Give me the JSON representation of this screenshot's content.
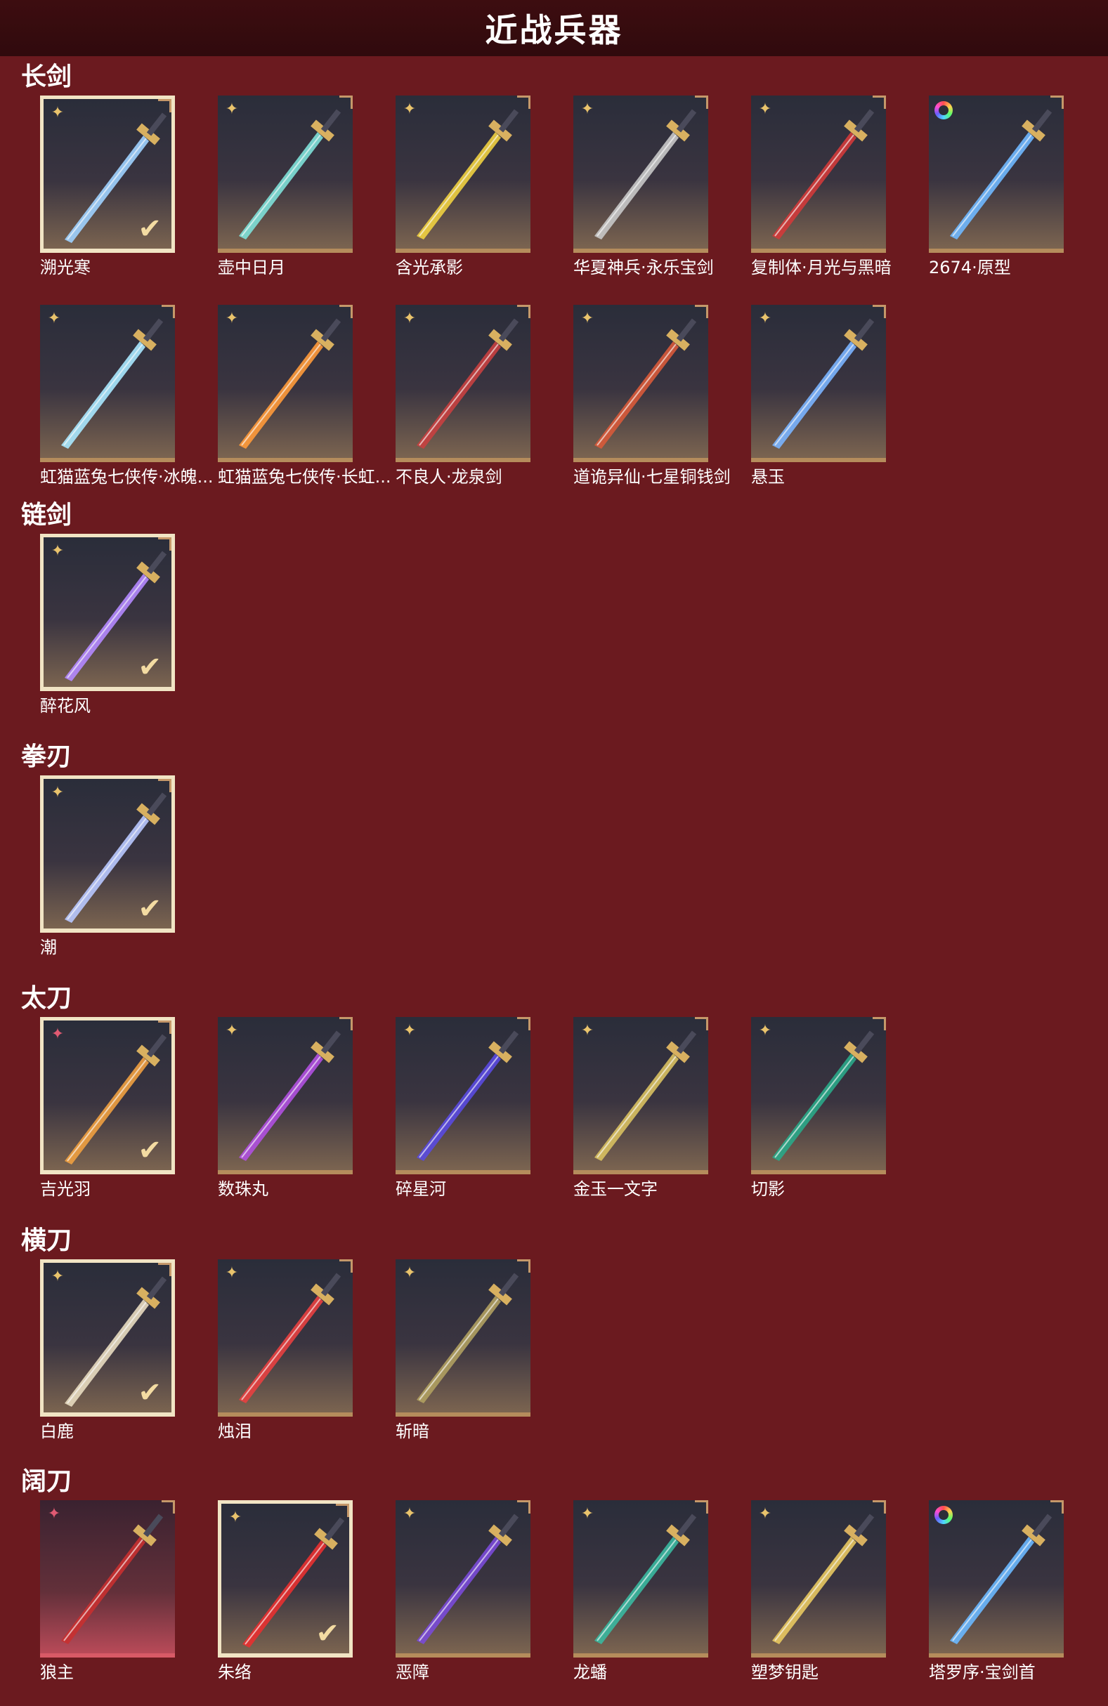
{
  "header": {
    "title": "近战兵器"
  },
  "categories": [
    {
      "label": "长剑",
      "items": [
        {
          "name": "溯光寒",
          "rarity": "gold",
          "owned": true,
          "color": "#9fd2ff"
        },
        {
          "name": "壶中日月",
          "rarity": "gold",
          "owned": false,
          "color": "#7ee0d8"
        },
        {
          "name": "含光承影",
          "rarity": "gold",
          "owned": false,
          "color": "#f0d040"
        },
        {
          "name": "华夏神兵·永乐宝剑",
          "rarity": "gold",
          "owned": false,
          "color": "#c8c8c8"
        },
        {
          "name": "复制体·月光与黑暗",
          "rarity": "gold",
          "owned": false,
          "color": "#d23a3a"
        },
        {
          "name": "2674·原型",
          "rarity": "rainbow",
          "owned": false,
          "color": "#6fb8ff"
        },
        {
          "name": "虹猫蓝兔七侠传·冰魄...",
          "rarity": "gold",
          "owned": false,
          "color": "#a8e8ff"
        },
        {
          "name": "虹猫蓝兔七侠传·长虹...",
          "rarity": "gold",
          "owned": false,
          "color": "#ff9a3a"
        },
        {
          "name": "不良人·龙泉剑",
          "rarity": "gold",
          "owned": false,
          "color": "#c84040"
        },
        {
          "name": "道诡异仙·七星铜钱剑",
          "rarity": "gold",
          "owned": false,
          "color": "#d85a3a"
        },
        {
          "name": "悬玉",
          "rarity": "gold",
          "owned": false,
          "color": "#7ab4ff"
        }
      ]
    },
    {
      "label": "链剑",
      "items": [
        {
          "name": "醉花风",
          "rarity": "gold",
          "owned": true,
          "color": "#b488ff"
        }
      ]
    },
    {
      "label": "拳刃",
      "items": [
        {
          "name": "潮",
          "rarity": "gold",
          "owned": true,
          "color": "#b8c8ff"
        }
      ]
    },
    {
      "label": "太刀",
      "items": [
        {
          "name": "吉光羽",
          "rarity": "pink",
          "owned": true,
          "color": "#f0a040"
        },
        {
          "name": "数珠丸",
          "rarity": "gold",
          "owned": false,
          "color": "#b050e0"
        },
        {
          "name": "碎星河",
          "rarity": "gold",
          "owned": false,
          "color": "#5a4ae0"
        },
        {
          "name": "金玉一文字",
          "rarity": "gold",
          "owned": false,
          "color": "#d8c060"
        },
        {
          "name": "切影",
          "rarity": "gold",
          "owned": false,
          "color": "#2aa888"
        }
      ]
    },
    {
      "label": "横刀",
      "items": [
        {
          "name": "白鹿",
          "rarity": "gold",
          "owned": true,
          "color": "#e8dcc0"
        },
        {
          "name": "烛泪",
          "rarity": "gold",
          "owned": false,
          "color": "#e84040"
        },
        {
          "name": "斩暗",
          "rarity": "gold",
          "owned": false,
          "color": "#b0a060"
        }
      ]
    },
    {
      "label": "阔刀",
      "items": [
        {
          "name": "狼主",
          "rarity": "pink",
          "owned": false,
          "color": "#c83030",
          "red_card": true
        },
        {
          "name": "朱络",
          "rarity": "gold",
          "owned": true,
          "color": "#e83030"
        },
        {
          "name": "恶障",
          "rarity": "gold",
          "owned": false,
          "color": "#7a4ad8"
        },
        {
          "name": "龙蟠",
          "rarity": "gold",
          "owned": false,
          "color": "#3ab8a0"
        },
        {
          "name": "塑梦钥匙",
          "rarity": "gold",
          "owned": false,
          "color": "#e8c860"
        },
        {
          "name": "塔罗序·宝剑首",
          "rarity": "rainbow",
          "owned": false,
          "color": "#6ab8ff"
        }
      ]
    }
  ]
}
